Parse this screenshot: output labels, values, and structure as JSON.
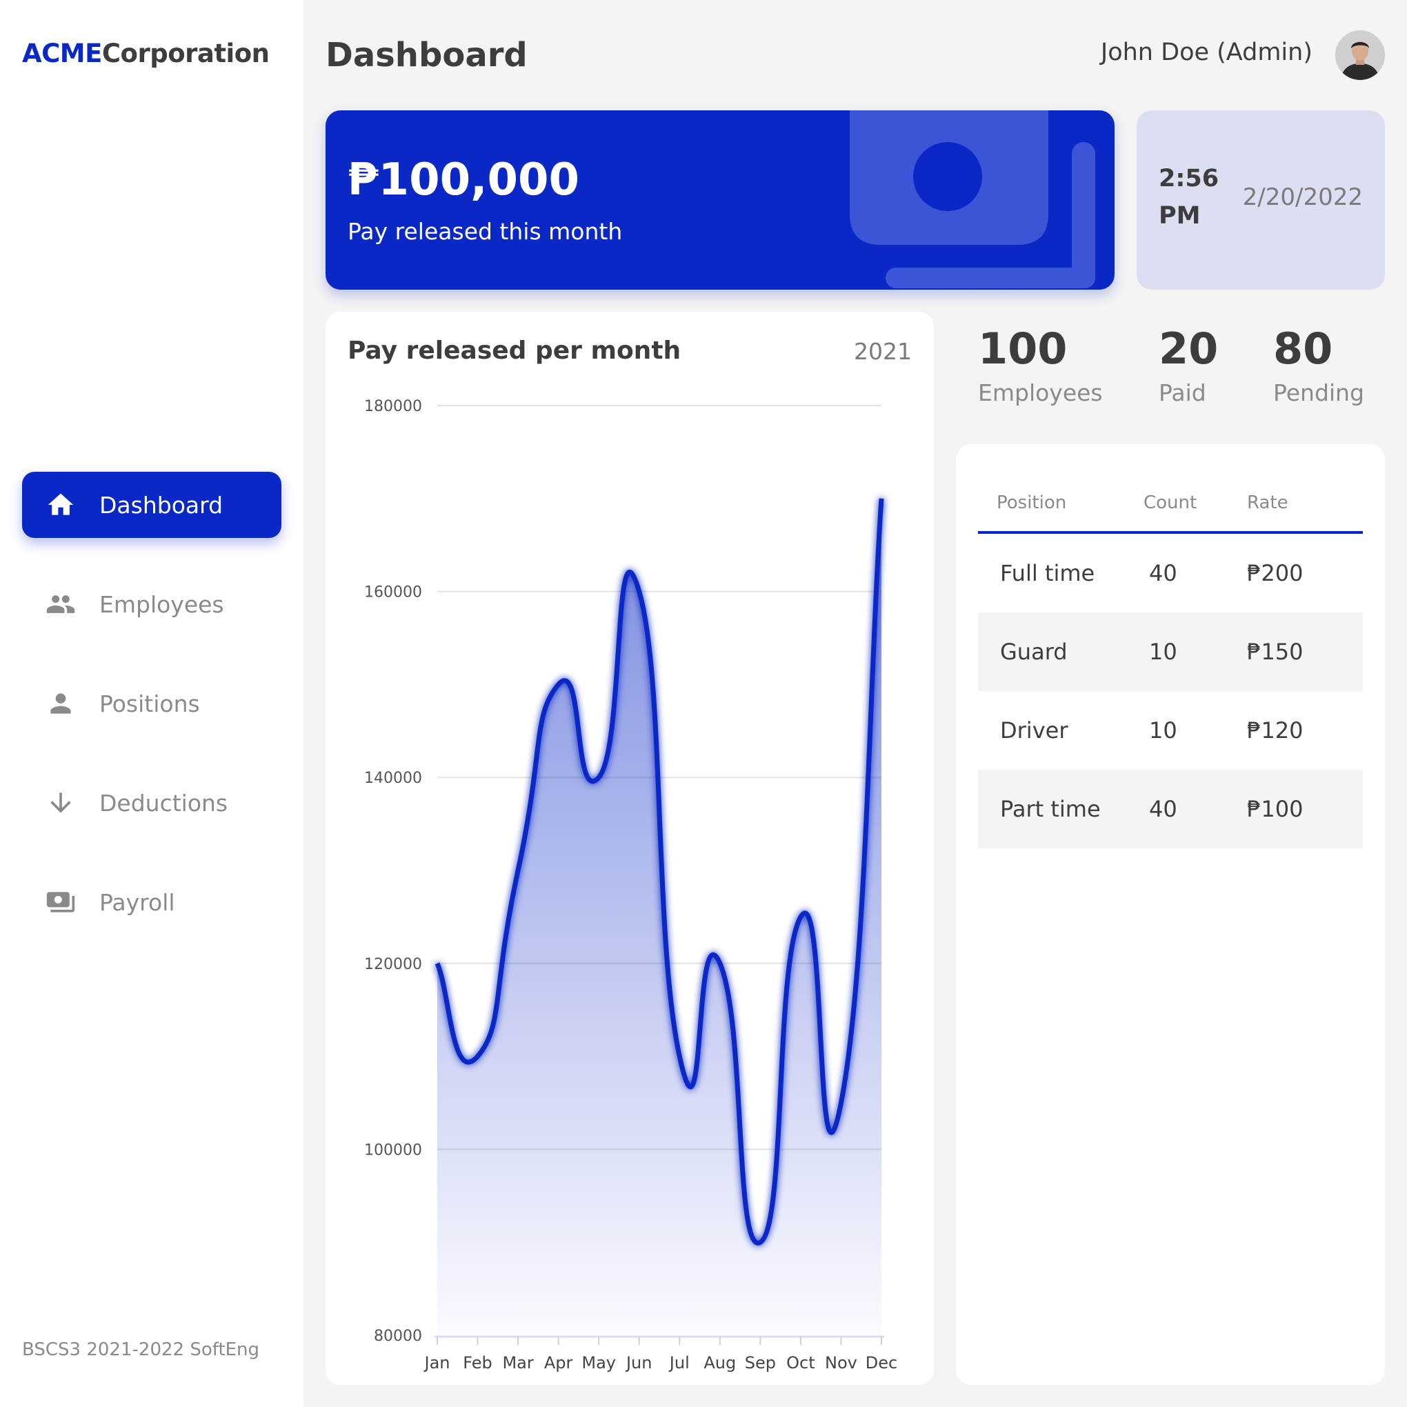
{
  "app": {
    "logo_brand": "ACME",
    "logo_rest": "Corporation",
    "footer": "BSCS3 2021-2022 SoftEng",
    "accent_color": "#0a28c6"
  },
  "header": {
    "title": "Dashboard",
    "user": "John Doe (Admin)"
  },
  "sidebar": {
    "items": [
      {
        "label": "Dashboard",
        "icon": "home-icon",
        "active": true
      },
      {
        "label": "Employees",
        "icon": "people-icon",
        "active": false
      },
      {
        "label": "Positions",
        "icon": "person-icon",
        "active": false
      },
      {
        "label": "Deductions",
        "icon": "arrow-down-icon",
        "active": false
      },
      {
        "label": "Payroll",
        "icon": "payments-icon",
        "active": false
      }
    ]
  },
  "pay_card": {
    "amount": "₱100,000",
    "caption": "Pay released this month",
    "icon": "payments-icon"
  },
  "clock": {
    "time": "2:56 PM",
    "date": "2/20/2022"
  },
  "stats": [
    {
      "value": "100",
      "label": "Employees"
    },
    {
      "value": "20",
      "label": "Paid"
    },
    {
      "value": "80",
      "label": "Pending"
    }
  ],
  "positions_table": {
    "headers": [
      "Position",
      "Count",
      "Rate"
    ],
    "rows": [
      [
        "Full time",
        "40",
        "₱200"
      ],
      [
        "Guard",
        "10",
        "₱150"
      ],
      [
        "Driver",
        "10",
        "₱120"
      ],
      [
        "Part time",
        "40",
        "₱100"
      ]
    ]
  },
  "chart_data": {
    "type": "area",
    "title": "Pay released per month",
    "period": "2021",
    "categories": [
      "Jan",
      "Feb",
      "Mar",
      "Apr",
      "May",
      "Jun",
      "Jul",
      "Aug",
      "Sep",
      "Oct",
      "Nov",
      "Dec"
    ],
    "series": [
      {
        "values": [
          120000,
          110000,
          130000,
          150000,
          140000,
          160000,
          110000,
          120000,
          90000,
          125000,
          105000,
          170000
        ]
      }
    ],
    "y_ticks": [
      180000,
      160000,
      140000,
      120000,
      100000,
      80000
    ],
    "ylim": [
      80000,
      180000
    ],
    "grid": true,
    "line_color": "#0a28c6"
  }
}
